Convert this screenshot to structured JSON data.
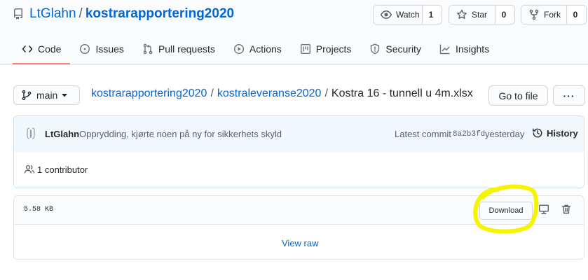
{
  "repo": {
    "owner": "LtGlahn",
    "separator": "/",
    "name": "kostrarapportering2020"
  },
  "actions": [
    {
      "label": "Watch",
      "count": "1",
      "icon": "eye-icon"
    },
    {
      "label": "Star",
      "count": "0",
      "icon": "star-icon"
    },
    {
      "label": "Fork",
      "count": "0",
      "icon": "fork-icon"
    }
  ],
  "tabs": [
    {
      "label": "Code",
      "icon": "code-icon",
      "selected": true
    },
    {
      "label": "Issues",
      "icon": "issue-icon"
    },
    {
      "label": "Pull requests",
      "icon": "pull-request-icon"
    },
    {
      "label": "Actions",
      "icon": "play-icon"
    },
    {
      "label": "Projects",
      "icon": "project-icon"
    },
    {
      "label": "Security",
      "icon": "shield-icon"
    },
    {
      "label": "Insights",
      "icon": "graph-icon"
    }
  ],
  "branch": {
    "label": "main"
  },
  "breadcrumb": {
    "root": "kostrarapportering2020",
    "folder": "kostraleveranse2020",
    "sep": "/",
    "file": "Kostra 16 - tunnell u 4m.xlsx"
  },
  "buttons": {
    "goto_file": "Go to file",
    "more": "···"
  },
  "commit": {
    "author": "LtGlahn",
    "message": "Opprydding, kjørte noen på ny for sikkerhets skyld",
    "latest_label": "Latest commit",
    "sha": "8a2b3fd",
    "time": "yesterday",
    "history": "History"
  },
  "contributors": {
    "text": "1 contributor"
  },
  "file": {
    "size": "5.58 KB",
    "download": "Download",
    "view_raw": "View raw"
  },
  "colors": {
    "link": "#0366d6",
    "highlight": "#f5f500",
    "tab_underline": "#f9826c"
  }
}
